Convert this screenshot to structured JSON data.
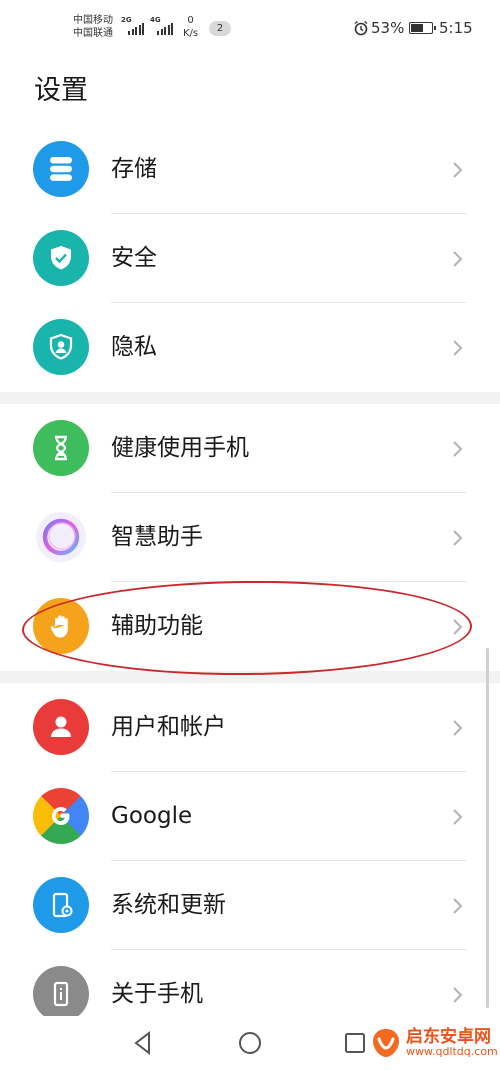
{
  "status_bar": {
    "carrier1": "中国移动",
    "carrier2": "中国联通",
    "net1": "2G",
    "net2": "4G",
    "speed_value": "0",
    "speed_unit": "K/s",
    "notif_count": "2",
    "battery": "53%",
    "time": "5:15"
  },
  "page": {
    "title": "设置"
  },
  "groups": [
    {
      "items": [
        {
          "label": "存储",
          "icon": "storage-icon",
          "color": "#1e9ae8"
        },
        {
          "label": "安全",
          "icon": "shield-check-icon",
          "color": "#19b5ad"
        },
        {
          "label": "隐私",
          "icon": "privacy-icon",
          "color": "#19b5ad"
        }
      ]
    },
    {
      "items": [
        {
          "label": "健康使用手机",
          "icon": "hourglass-icon",
          "color": "#3dbd5b"
        },
        {
          "label": "智慧助手",
          "icon": "assistant-ring-icon",
          "color": "#b56cf0"
        },
        {
          "label": "辅助功能",
          "icon": "hand-icon",
          "color": "#f5a31a"
        }
      ]
    },
    {
      "items": [
        {
          "label": "用户和帐户",
          "icon": "user-icon",
          "color": "#ea3b3b"
        },
        {
          "label": "Google",
          "icon": "google-icon",
          "color": "#4285f4"
        },
        {
          "label": "系统和更新",
          "icon": "system-update-icon",
          "color": "#1e9ae8"
        },
        {
          "label": "关于手机",
          "icon": "phone-info-icon",
          "color": "#8a8a8a"
        }
      ]
    }
  ],
  "watermark": {
    "title": "启东安卓网",
    "url": "www.qdltdq.com"
  }
}
